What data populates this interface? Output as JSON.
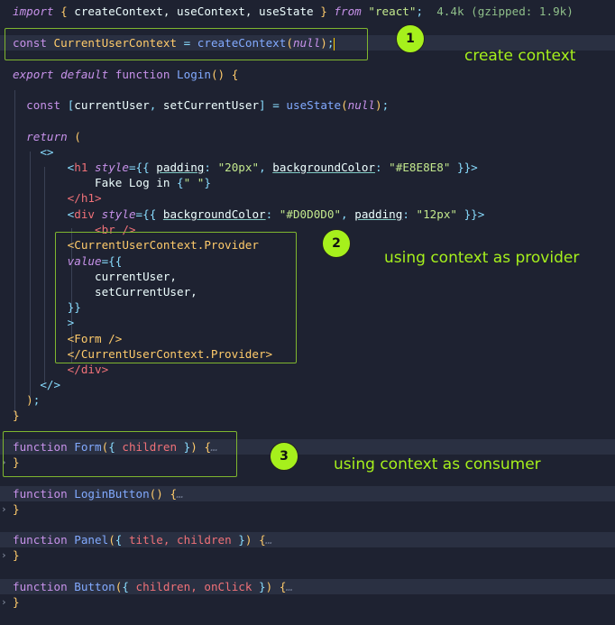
{
  "editor": {
    "import_line": {
      "kw_import": "import",
      "brace_open": "{",
      "names": " createContext, useContext, useState ",
      "brace_close": "}",
      "kw_from": "from",
      "module": "\"react\"",
      "semi": ";",
      "size_info": "4.4k (gzipped: 1.9k)"
    },
    "context_line": {
      "kw_const": "const",
      "name": "CurrentUserContext",
      "eq": "=",
      "fn": "createContext",
      "arg": "null"
    },
    "login_decl": {
      "kw_export": "export",
      "kw_default": "default",
      "kw_function": "function",
      "name": "Login"
    },
    "state_line": {
      "kw_const": "const",
      "var1": "currentUser",
      "var2": "setCurrentUser",
      "fn": "useState",
      "arg": "null"
    },
    "return_kw": "return",
    "fragment_open": "<>",
    "h1": {
      "tag": "h1",
      "attr": "style",
      "prop1": "padding",
      "val1": "\"20px\"",
      "prop2": "backgroundColor",
      "val2": "\"#E8E8E8\"",
      "text": "Fake Log in",
      "space": "\" \"",
      "close": "</h1>"
    },
    "div": {
      "tag": "div",
      "attr": "style",
      "prop1": "backgroundColor",
      "val1": "\"#D0D0D0\"",
      "prop2": "padding",
      "val2": "\"12px\""
    },
    "br": "<br />",
    "provider": {
      "open": "<CurrentUserContext.Provider",
      "attr": "value",
      "item1": "currentUser,",
      "item2": "setCurrentUser,",
      "form": "<Form />",
      "close": "</CurrentUserContext.Provider>"
    },
    "div_close": "</div>",
    "fragment_close": "</>",
    "functions": [
      {
        "kw": "function",
        "name": "Form",
        "params": "children"
      },
      {
        "kw": "function",
        "name": "LoginButton",
        "params": ""
      },
      {
        "kw": "function",
        "name": "Panel",
        "params": "title, children"
      },
      {
        "kw": "function",
        "name": "Button",
        "params": "children, onClick"
      }
    ]
  },
  "annotations": [
    {
      "number": "1",
      "label": "create context"
    },
    {
      "number": "2",
      "label": "using context as provider"
    },
    {
      "number": "3",
      "label": "using context as consumer"
    }
  ],
  "colors": {
    "annotation": "#a6f01c",
    "box": "#7fb62f",
    "background": "#1e2231"
  }
}
